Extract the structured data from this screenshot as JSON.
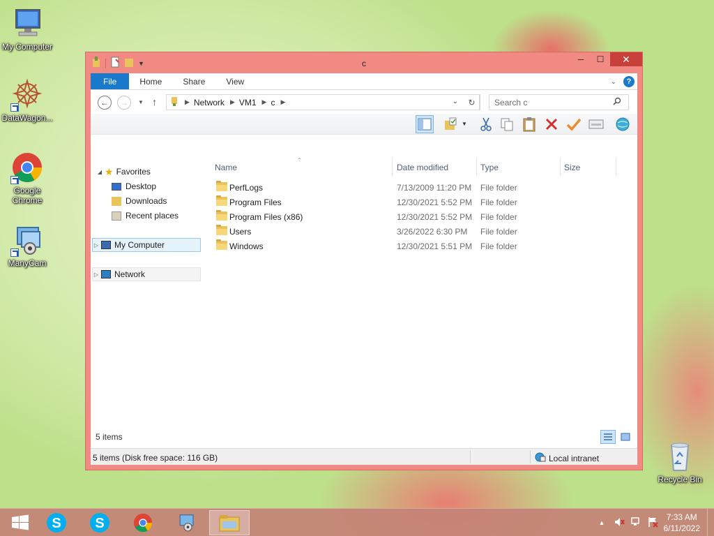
{
  "desktop": {
    "icons": [
      {
        "label": "My Computer"
      },
      {
        "label": "DataWagon..."
      },
      {
        "label": "Google Chrome"
      },
      {
        "label": "ManyCam"
      },
      {
        "label": "Recycle Bin"
      }
    ]
  },
  "window": {
    "title": "c",
    "ribbon_tabs": [
      "File",
      "Home",
      "Share",
      "View"
    ],
    "address": {
      "segments": [
        "Network",
        "VM1",
        "c"
      ]
    },
    "search": {
      "placeholder": "Search c"
    },
    "nav": {
      "favorites": "Favorites",
      "desktop": "Desktop",
      "downloads": "Downloads",
      "recent": "Recent places",
      "my_computer": "My Computer",
      "network": "Network"
    },
    "columns": {
      "name": "Name",
      "date": "Date modified",
      "type": "Type",
      "size": "Size"
    },
    "files": [
      {
        "name": "PerfLogs",
        "date": "7/13/2009 11:20 PM",
        "type": "File folder"
      },
      {
        "name": "Program Files",
        "date": "12/30/2021 5:52 PM",
        "type": "File folder"
      },
      {
        "name": "Program Files (x86)",
        "date": "12/30/2021 5:52 PM",
        "type": "File folder"
      },
      {
        "name": "Users",
        "date": "3/26/2022 6:30 PM",
        "type": "File folder"
      },
      {
        "name": "Windows",
        "date": "12/30/2021 5:51 PM",
        "type": "File folder"
      }
    ],
    "item_count": "5 items",
    "status": {
      "left": "5 items (Disk free space: 116 GB)",
      "zone": "Local intranet"
    }
  },
  "taskbar": {
    "time": "7:33 AM",
    "date": "6/11/2022"
  },
  "colors": {
    "file_tab": "#1979ca",
    "window_frame": "#f08a82",
    "close_button": "#c7403a"
  }
}
